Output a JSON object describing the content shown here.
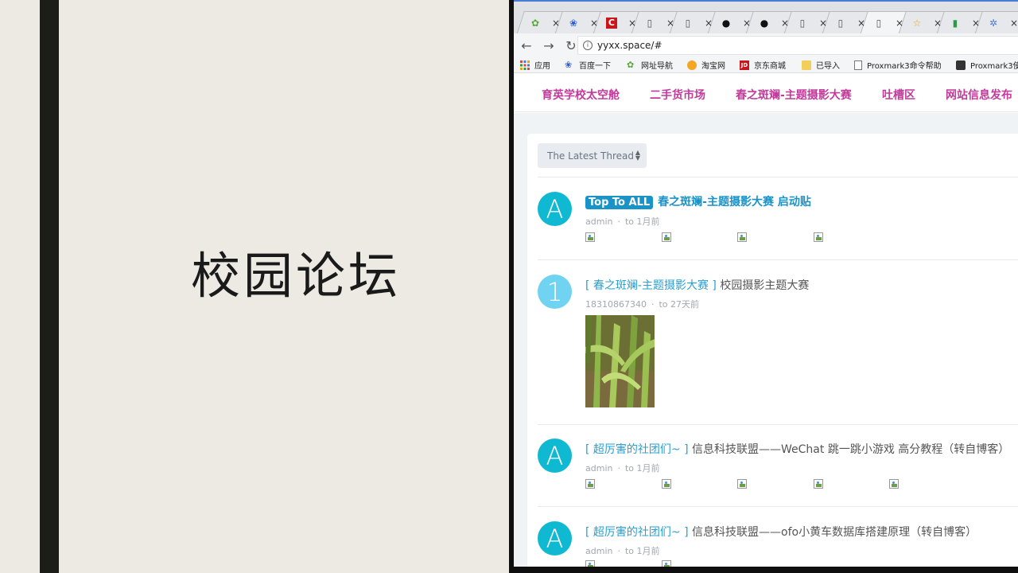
{
  "slide": {
    "title": "校园论坛"
  },
  "browser": {
    "url": "yyxx.space/#",
    "tabs": [
      {
        "icon": "hao123-icon",
        "glyph": "✿"
      },
      {
        "icon": "baidu-icon",
        "glyph": "❀"
      },
      {
        "icon": "csdn-icon",
        "glyph": "C"
      },
      {
        "icon": "page-icon",
        "glyph": "▯"
      },
      {
        "icon": "page-icon",
        "glyph": "▯"
      },
      {
        "icon": "github-icon",
        "glyph": "●"
      },
      {
        "icon": "github-icon",
        "glyph": "●"
      },
      {
        "icon": "page-icon",
        "glyph": "▯"
      },
      {
        "icon": "page-icon",
        "glyph": "▯"
      },
      {
        "icon": "page-icon",
        "glyph": "▯"
      },
      {
        "icon": "star-icon",
        "glyph": "☆"
      },
      {
        "icon": "chart-icon",
        "glyph": "▮"
      },
      {
        "icon": "gear-icon",
        "glyph": "✲"
      }
    ],
    "close_glyph": "×",
    "bookmarks": [
      {
        "label": "应用",
        "icon": "apps-icon",
        "color": "#d44"
      },
      {
        "label": "百度一下",
        "icon": "baidu-icon",
        "color": "#2b5dd6"
      },
      {
        "label": "网址导航",
        "icon": "hao123-icon",
        "color": "#5aa83a"
      },
      {
        "label": "淘宝网",
        "icon": "taobao-icon",
        "color": "#f5a623"
      },
      {
        "label": "京东商城",
        "icon": "jd-icon",
        "color": "#c8161d"
      },
      {
        "label": "已导入",
        "icon": "folder-icon",
        "color": "#f1cf5a"
      },
      {
        "label": "Proxmark3命令帮助",
        "icon": "page-icon",
        "color": "#ffffff"
      },
      {
        "label": "Proxmark3使",
        "icon": "doc-icon",
        "color": "#333333"
      }
    ]
  },
  "site": {
    "nav": [
      "育英学校太空舱",
      "二手货市场",
      "春之斑斓-主题摄影大赛",
      "吐槽区",
      "网站信息发布"
    ],
    "sort_label": "The Latest Thread",
    "threads": [
      {
        "avatar": "A",
        "badge": "Top To ALL",
        "title": "春之斑斓-主题摄影大赛 启动贴",
        "author": "admin",
        "time": "to 1月前",
        "images": 4
      },
      {
        "avatar": "1",
        "tag": "[ 春之斑斓-主题摄影大赛 ]",
        "title": "校园摄影主题大赛",
        "author": "18310867340",
        "time": "to 27天前",
        "images": 0
      },
      {
        "avatar": "A",
        "tag": "[ 超厉害的社团们~ ]",
        "title": "信息科技联盟——WeChat 跳一跳小游戏 高分教程（转自博客）",
        "author": "admin",
        "time": "to 1月前",
        "images": 5
      },
      {
        "avatar": "A",
        "tag": "[ 超厉害的社团们~ ]",
        "title": "信息科技联盟——ofo小黄车数据库搭建原理（转自博客）",
        "author": "admin",
        "time": "to 1月前",
        "images": 0
      }
    ]
  },
  "colors": {
    "nav_link": "#c23a9a",
    "accent": "#1a93c8",
    "avatar_teal": "#10b9d2",
    "avatar_light": "#6fd3f1"
  }
}
